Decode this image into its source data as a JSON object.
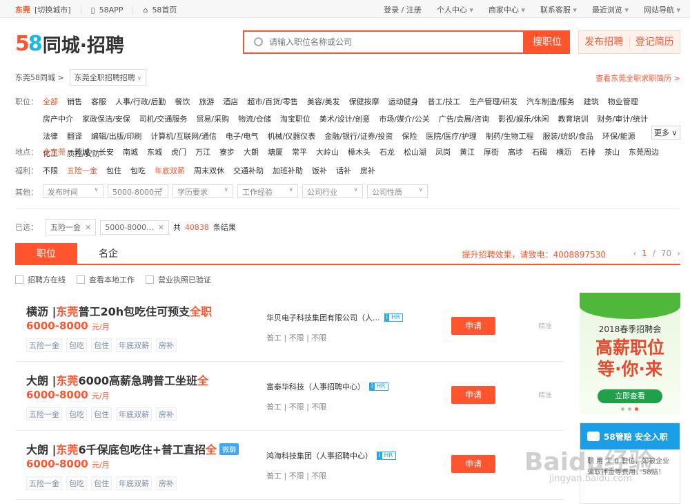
{
  "topbar": {
    "city": "东莞",
    "switch_city": "[切换城市]",
    "app": "58APP",
    "home": "58首页",
    "links": [
      "登录 / 注册",
      "个人中心",
      "商家中心",
      "联系客服",
      "最近浏览",
      "网站导航"
    ]
  },
  "logo": {
    "num5": "5",
    "num8": "8",
    "text": "同城·招聘"
  },
  "search": {
    "placeholder": "请输入职位名称或公司",
    "button": "搜职位"
  },
  "actions": {
    "publish": "发布招聘",
    "resume": "登记简历"
  },
  "breadcrumb": {
    "home": "东莞58同城 >",
    "current": "东莞全职招聘招聘",
    "view_resume": "查看东莞全职求职简历 >"
  },
  "filters": {
    "position": {
      "label": "职位：",
      "values": [
        "全部",
        "销售",
        "客服",
        "人事/行政/后勤",
        "餐饮",
        "旅游",
        "酒店",
        "超市/百货/零售",
        "美容/美发",
        "保健按摩",
        "运动健身",
        "普工/技工",
        "生产管理/研发",
        "汽车制造/服务",
        "建筑",
        "物业管理",
        "房产中介",
        "家政保洁/安保",
        "司机/交通服务",
        "贸易/采购",
        "物流/仓储",
        "淘宝职位",
        "美术/设计/创意",
        "市场/媒介/公关",
        "广告/会展/咨询",
        "影视/娱乐/休闲",
        "教育培训",
        "财务/审计/统计",
        "法律",
        "翻译",
        "编辑/出版/印刷",
        "计算机/互联网/通信",
        "电子/电气",
        "机械/仪器仪表",
        "金融/银行/证券/投资",
        "保险",
        "医院/医疗/护理",
        "制药/生物工程",
        "服装/纺织/食品",
        "环保/能源",
        "化工",
        "质控/安防"
      ],
      "more": "更多"
    },
    "location": {
      "label": "地点：",
      "values": [
        "全东莞",
        "莞城",
        "长安",
        "南城",
        "东城",
        "虎门",
        "万江",
        "寮步",
        "大朗",
        "塘厦",
        "常平",
        "大岭山",
        "樟木头",
        "石龙",
        "松山湖",
        "凤岗",
        "黄江",
        "厚街",
        "高埗",
        "石碣",
        "横沥",
        "石排",
        "茶山",
        "东莞周边"
      ]
    },
    "welfare": {
      "label": "福利：",
      "values": [
        "不限",
        "五险一金",
        "包住",
        "包吃",
        "年底双薪",
        "周末双休",
        "交通补助",
        "加班补助",
        "饭补",
        "话补",
        "房补"
      ]
    },
    "other": {
      "label": "其他：",
      "selects": [
        "发布时间",
        "5000-8000元",
        "学历要求",
        "工作经验",
        "公司行业",
        "公司性质"
      ]
    }
  },
  "chosen": {
    "label": "已选：",
    "chips": [
      "五险一金",
      "5000-8000..."
    ],
    "total_prefix": "共",
    "total": "40838",
    "total_suffix": "条结果"
  },
  "tabs": {
    "jobs": "职位",
    "companies": "名企",
    "promo": "提升招聘效果，请致电：4008897530",
    "page_current": "1",
    "page_sep": "/",
    "page_total": "70"
  },
  "checks": [
    "招聘方在线",
    "查看本地工作",
    "营业执照已验证"
  ],
  "jobs": [
    {
      "place": "横沥 | ",
      "hl": "东莞",
      "rest": "普工20h包吃住可预支",
      "hl2": "全职",
      "salary": "6000-8000",
      "unit": "元/月",
      "tags": [
        "五险一金",
        "包吃",
        "包住",
        "年底双薪",
        "房补"
      ],
      "company": "华贝电子科技集团有限公司（人...",
      "info": "普工 | 不限 | 不限",
      "apply": "申请",
      "time": "精准",
      "weiliao": ""
    },
    {
      "place": "大朗 | ",
      "hl": "东莞",
      "rest": "6000高薪急聘普工坐班",
      "hl2": "全",
      "salary": "6000-8000",
      "unit": "元/月",
      "tags": [
        "五险一金",
        "包吃",
        "包住",
        "年底双薪",
        "房补"
      ],
      "company": "富泰华科技（人事招聘中心）",
      "info": "普工 | 不限 | 不限",
      "apply": "申请",
      "time": "精准",
      "weiliao": ""
    },
    {
      "place": "大朗 | ",
      "hl": "东莞",
      "rest": "6千保底包吃住+普工直招",
      "hl2": "全",
      "salary": "6000-8000",
      "unit": "元/月",
      "tags": [
        "五险一金",
        "包吃",
        "包住",
        "年底双薪",
        "房补"
      ],
      "company": "鸿海科技集团（人事招聘中心）",
      "info": "普工 | 不限 | 不限",
      "apply": "申请",
      "time": "",
      "weiliao": "微聊"
    }
  ],
  "hr_badge": {
    "icon": "i",
    "text": "HR"
  },
  "ad1": {
    "year": "2018春季招聘会",
    "line1": "高薪职位",
    "line2": "等·你·来",
    "cta": "立即查看"
  },
  "ad2": {
    "title": "58管赔 安全入职",
    "body": "职  用  工   0  职位，如被企业骗取押金等费用，58赔！"
  },
  "watermark": {
    "main": "Baidu经验",
    "sub": "jingyan.baidu.com"
  }
}
